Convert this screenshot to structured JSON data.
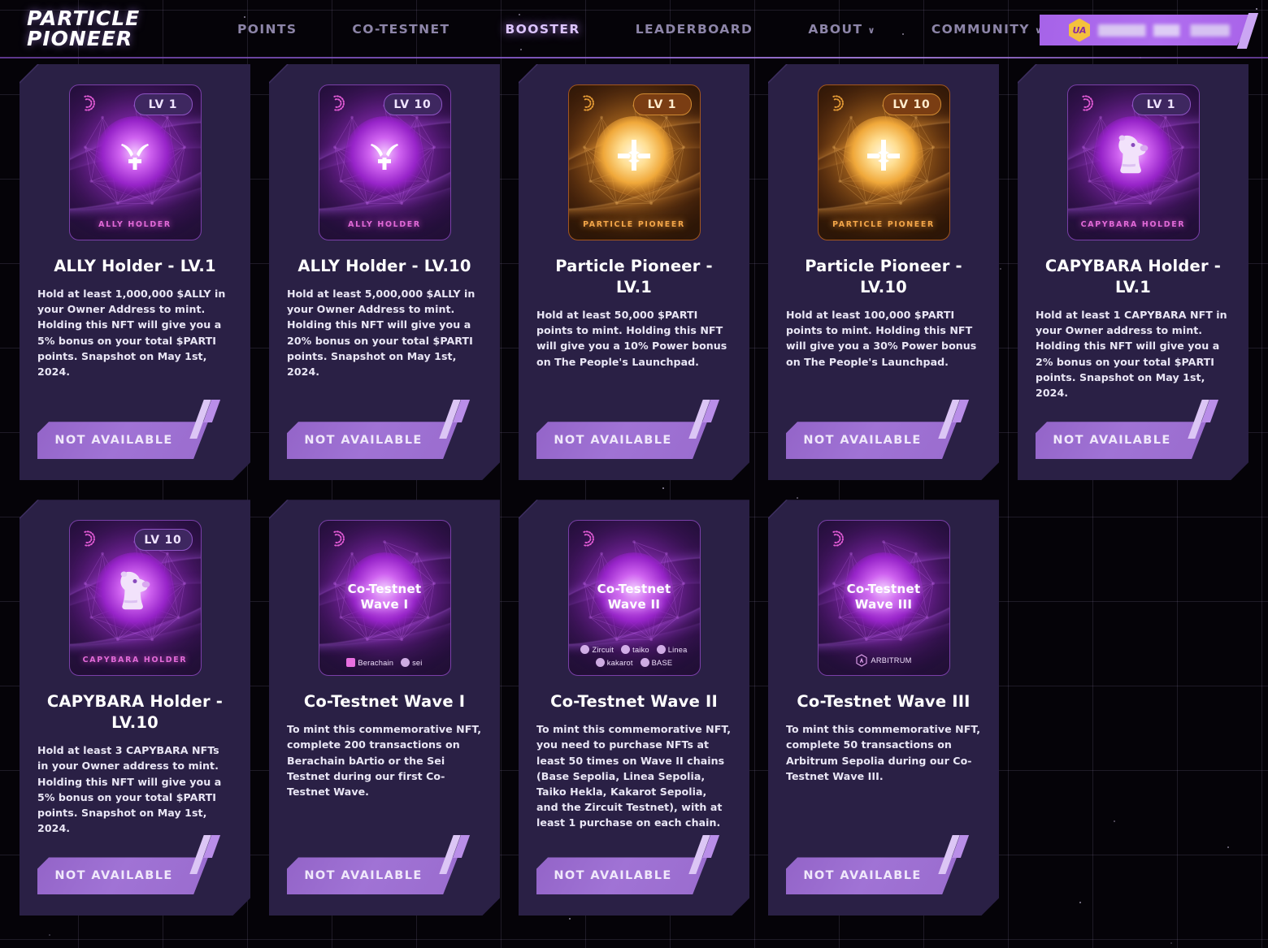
{
  "header": {
    "logo_line1": "PARTICLE",
    "logo_line2": "PIONEER",
    "nav": [
      {
        "label": "POINTS",
        "active": false,
        "caret": ""
      },
      {
        "label": "CO-TESTNET",
        "active": false,
        "caret": ""
      },
      {
        "label": "BOOSTER",
        "active": true,
        "caret": ""
      },
      {
        "label": "LEADERBOARD",
        "active": false,
        "caret": ""
      },
      {
        "label": "ABOUT",
        "active": false,
        "caret": "∨"
      },
      {
        "label": "COMMUNITY",
        "active": false,
        "caret": "∨"
      }
    ],
    "wallet": {
      "logo_text": "UA",
      "address": ""
    }
  },
  "cards": [
    {
      "id": "ally-holder-lv1",
      "theme": "purple",
      "art_kind": "logo",
      "badge": "LV 1",
      "caption": "ALLY HOLDER",
      "title": "ALLY Holder - LV.1",
      "desc": "Hold at least 1,000,000 $ALLY in your Owner Address to mint. Holding this NFT will give you a 5% bonus on your total $PARTI points. Snapshot on May 1st, 2024.",
      "button": "NOT AVAILABLE"
    },
    {
      "id": "ally-holder-lv10",
      "theme": "purple",
      "art_kind": "logo",
      "badge": "LV 10",
      "caption": "ALLY HOLDER",
      "title": "ALLY Holder - LV.10",
      "desc": "Hold at least 5,000,000 $ALLY in your Owner Address to mint. Holding this NFT will give you a 20% bonus on your total $PARTI points. Snapshot on May 1st, 2024.",
      "button": "NOT AVAILABLE"
    },
    {
      "id": "particle-pioneer-lv1",
      "theme": "gold",
      "art_kind": "cross",
      "badge": "LV 1",
      "caption": "PARTICLE PIONEER",
      "title": "Particle Pioneer - LV.1",
      "desc": "Hold at least 50,000 $PARTI points to mint. Holding this NFT will give you a 10% Power bonus on The People's Launchpad.",
      "button": "NOT AVAILABLE"
    },
    {
      "id": "particle-pioneer-lv10",
      "theme": "gold",
      "art_kind": "cross",
      "badge": "LV 10",
      "caption": "PARTICLE PIONEER",
      "title": "Particle Pioneer - LV.10",
      "desc": "Hold at least 100,000 $PARTI points to mint. Holding this NFT will give you a 30% Power bonus on The People's Launchpad.",
      "button": "NOT AVAILABLE"
    },
    {
      "id": "capybara-holder-lv1",
      "theme": "purple",
      "art_kind": "capybara",
      "badge": "LV 1",
      "caption": "CAPYBARA HOLDER",
      "title": "CAPYBARA Holder - LV.1",
      "desc": "Hold at least 1 CAPYBARA NFT in your Owner address to mint. Holding this NFT will give you a 2% bonus on your total $PARTI points. Snapshot on May 1st, 2024.",
      "button": "NOT AVAILABLE"
    },
    {
      "id": "capybara-holder-lv10",
      "theme": "purple",
      "art_kind": "capybara",
      "badge": "LV 10",
      "caption": "CAPYBARA HOLDER",
      "title": "CAPYBARA Holder - LV.10",
      "desc": "Hold at least 3 CAPYBARA NFTs in your Owner address to mint. Holding this NFT will give you a 5% bonus on your total $PARTI points. Snapshot on May 1st, 2024.",
      "button": "NOT AVAILABLE"
    },
    {
      "id": "co-testnet-wave-1",
      "theme": "purple",
      "art_kind": "wave",
      "badge": "",
      "art_title": "Co-Testnet\nWave I",
      "chains": [
        "Berachain",
        "sei"
      ],
      "title": "Co-Testnet Wave I",
      "desc": "To mint this commemorative NFT, complete 200 transactions on Berachain bArtio or the Sei Testnet during our first Co-Testnet Wave.",
      "button": "NOT AVAILABLE"
    },
    {
      "id": "co-testnet-wave-2",
      "theme": "purple",
      "art_kind": "wave",
      "badge": "",
      "art_title": "Co-Testnet\nWave II",
      "chains": [
        "Zircuit",
        "taiko",
        "Linea",
        "kakarot",
        "BASE"
      ],
      "title": "Co-Testnet Wave II",
      "desc": "To mint this commemorative NFT, you need to purchase NFTs at least 50 times on Wave II chains (Base Sepolia, Linea Sepolia, Taiko Hekla, Kakarot Sepolia, and the Zircuit Testnet), with at least 1 purchase on each chain.",
      "button": "NOT AVAILABLE"
    },
    {
      "id": "co-testnet-wave-3",
      "theme": "purple",
      "art_kind": "wave",
      "badge": "",
      "art_title": "Co-Testnet\nWave III",
      "chains": [
        "ARBITRUM"
      ],
      "title": "Co-Testnet Wave III",
      "desc": "To mint this commemorative NFT, complete 50 transactions on Arbitrum Sepolia during our Co-Testnet Wave III.",
      "button": "NOT AVAILABLE"
    }
  ],
  "colors": {
    "page_bg": "#050308",
    "card_bg": "#2a2045",
    "accent_purple": "#a073d5",
    "accent_gold": "#f0a83a",
    "nav_active": "#dcc4ff",
    "nav_idle": "#8d85a8"
  }
}
